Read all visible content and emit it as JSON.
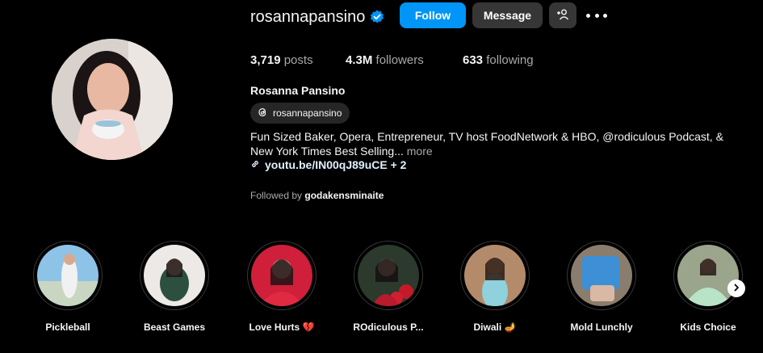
{
  "profile": {
    "username": "rosannapansino",
    "full_name": "Rosanna Pansino",
    "threads_handle": "rosannapansino",
    "bio": "Fun Sized Baker, Opera, Entrepreneur, TV host FoodNetwork & HBO, @rodiculous Podcast, & New York Times Best Selling...",
    "bio_more": "more",
    "link_text": "youtu.be/IN00qJ89uCE + 2",
    "followed_by_prefix": "Followed by",
    "followed_by_user": "godakensminaite"
  },
  "actions": {
    "follow_label": "Follow",
    "message_label": "Message"
  },
  "stats": {
    "posts_count": "3,719",
    "posts_label": "posts",
    "followers_count": "4.3M",
    "followers_label": "followers",
    "following_count": "633",
    "following_label": "following"
  },
  "highlights": [
    {
      "label": "Pickleball"
    },
    {
      "label": "Beast Games"
    },
    {
      "label": "Love Hurts 💔"
    },
    {
      "label": "ROdiculous P..."
    },
    {
      "label": "Diwali 🪔"
    },
    {
      "label": "Mold Lunchly"
    },
    {
      "label": "Kids Choice"
    }
  ],
  "colors": {
    "background": "#000000",
    "follow_button": "#0095f6",
    "secondary_button": "#363636",
    "verified_badge": "#0095f6",
    "muted_text": "#a8a8a8"
  },
  "icons": {
    "verified": "verified-badge-icon",
    "add_user": "add-user-icon",
    "more": "more-options-icon",
    "threads": "threads-icon",
    "link": "link-icon",
    "next": "chevron-right-icon"
  }
}
